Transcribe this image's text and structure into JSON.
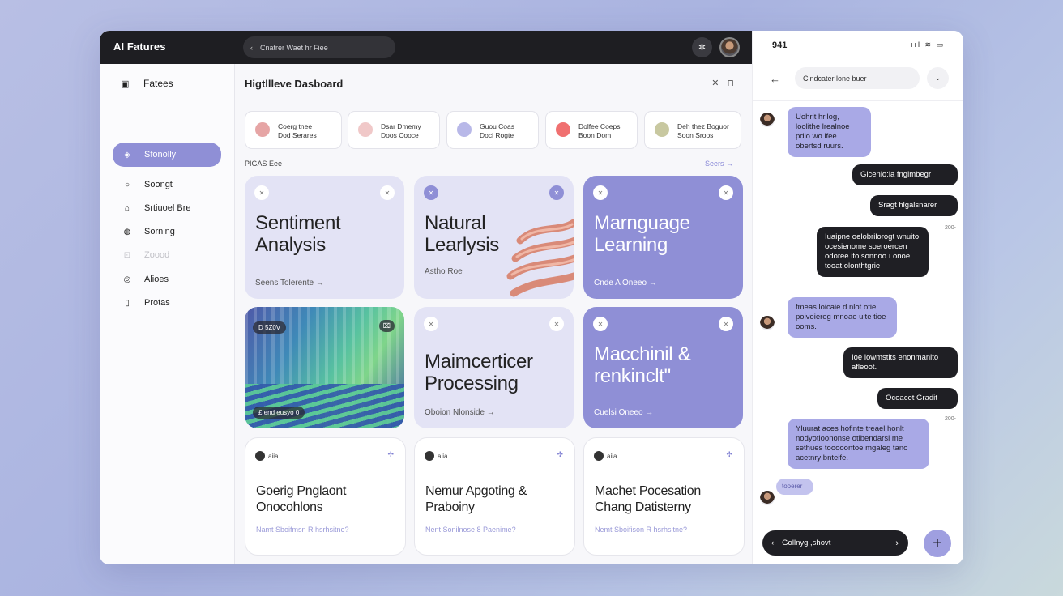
{
  "app": {
    "title": "AI Fatures",
    "search_placeholder": "Cnatrer Waet hr Fiee",
    "search_icon": "back-chevron-icon",
    "gear_icon": "✲"
  },
  "sidebar": {
    "header": "Fatees",
    "items": [
      {
        "label": "Sfonolly",
        "icon": "◈",
        "active": true
      },
      {
        "label": "Soongt",
        "icon": "○"
      },
      {
        "label": "Srtiuoel Bre",
        "icon": "⌂"
      },
      {
        "label": "Sornlng",
        "icon": "◍"
      },
      {
        "label": "Zoood",
        "icon": "⊡",
        "dim": true
      },
      {
        "label": "Alioes",
        "icon": "◎"
      },
      {
        "label": "Protas",
        "icon": "▯"
      }
    ]
  },
  "main": {
    "title": "Higtllleve Dasboard",
    "head_icons": [
      "✕",
      "⊓"
    ],
    "quick": [
      {
        "l1": "Coerg tnee",
        "l2": "Dod Serares",
        "color": "#e6a5a5"
      },
      {
        "l1": "Dsar Dmemy",
        "l2": "Doos Cooce",
        "color": "#f0c8c8"
      },
      {
        "l1": "Guou Coas",
        "l2": "Doci Rogte",
        "color": "#b8b8e8"
      },
      {
        "l1": "Dolfee Coeps",
        "l2": "Boon Dom",
        "color": "#f07070"
      },
      {
        "l1": "Deh thez Boguor",
        "l2": "Soon Sroos",
        "color": "#c8c8a0"
      }
    ],
    "section_label": "PIGAS Eee",
    "section_link": "Seers →",
    "cards": [
      {
        "title_1": "Sentiment",
        "title_2": "Analysis",
        "footer": "Seens Tolerente →"
      },
      {
        "title_1": "Natural",
        "title_2": "Learlysis",
        "footer": "Astho Roe"
      },
      {
        "title_1": "Marnguage",
        "title_2": "Learning",
        "footer": "Cnde A Oneeo →"
      },
      {
        "chip_top": "D 5Z0V",
        "chip_bottom": "£ end eusyo 0"
      },
      {
        "title_1": "Maimcerticer",
        "title_2": "Processing",
        "footer": "Oboion Nlonside →"
      },
      {
        "title_1": "Macchinil &",
        "title_2": "renkinclt\"",
        "footer": "Cuelsi Oneeo →"
      },
      {
        "tag": "aiia",
        "title_1": "Goerig Pnglaont",
        "title_2": "Onocohlons",
        "footer": "Namt Sboifmsn R hsrhsitne?"
      },
      {
        "tag": "aiia",
        "title_1": "Nemur Apgoting &",
        "title_2": "Praboiny",
        "footer": "Nent Sonilnose 8 Paenime?"
      },
      {
        "tag": "aiia",
        "title_1": "Machet Pocesation",
        "title_2": "Chang Datisterny",
        "footer": "Nemt Sboifison R hsrhsitne?"
      }
    ]
  },
  "phone": {
    "time": "941",
    "status_icons": "ııl ≋ ▭",
    "search_text": "Cindcater lone buer",
    "messages": [
      {
        "side": "in",
        "text": "Uohrit hrllog, loolithe lrealnoe pdio wo ifee obertsd ruurs."
      },
      {
        "side": "out",
        "text": "Gicenio:la fngimbegr"
      },
      {
        "side": "out",
        "text": "Sragt hlgalsnarer"
      },
      {
        "side": "out",
        "text": "Iuaipne oelobrilorogt wnuito ocesienome soeroercen odoree ito sonnoo ı onoe tooat olonthtgrie"
      },
      {
        "side": "in",
        "text": "fmeas loicaie d nlot otie poivoiereg mnoae ulte tioe ooms."
      },
      {
        "side": "out",
        "text": "Ioe lowmstits enonmanito afleoot."
      },
      {
        "side": "out",
        "text": "Oceacet Gradit"
      },
      {
        "side": "in",
        "text": "Yluurat aces hofinte treael honlt nodyotioononse otibendarsi me sethues tooooontoe mgaleg tano acetnry bnteife."
      },
      {
        "side": "in",
        "text": "tooerer"
      }
    ],
    "timestamps": [
      "200-",
      "200-"
    ],
    "compose_text": "Gollnyg ,shovt",
    "fab": "+"
  }
}
